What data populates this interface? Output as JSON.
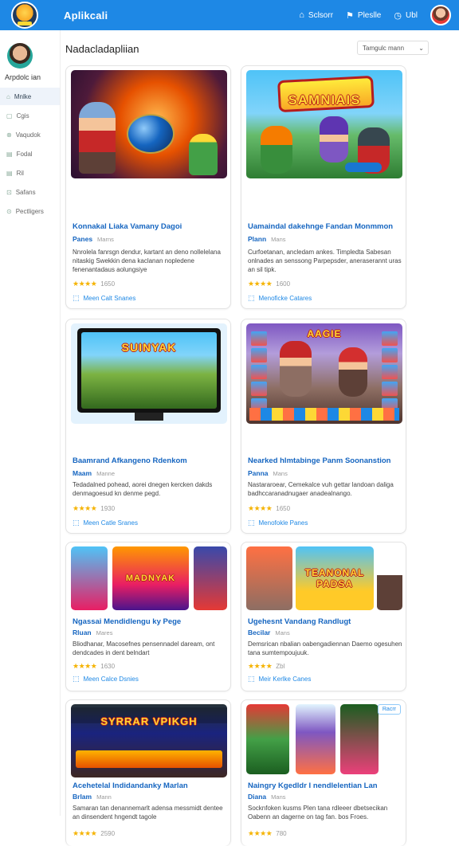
{
  "app": {
    "title": "Aplikcali"
  },
  "topnav": [
    {
      "icon": "bell-icon",
      "glyph": "⌂",
      "label": "Sclsorr"
    },
    {
      "icon": "flag-icon",
      "glyph": "⚑",
      "label": "Pleslle"
    },
    {
      "icon": "clock-icon",
      "glyph": "◷",
      "label": "Ubl"
    }
  ],
  "sidebar": {
    "user_name": "Arpdolc ian",
    "items": [
      {
        "label": "Mnlke",
        "glyph": "⌂"
      },
      {
        "label": "Cgis",
        "glyph": "▢"
      },
      {
        "label": "Vaqudok",
        "glyph": "⊗"
      },
      {
        "label": "Fodal",
        "glyph": "▤"
      },
      {
        "label": "Ril",
        "glyph": "▤"
      },
      {
        "label": "Safans",
        "glyph": "⊡"
      },
      {
        "label": "Pectligers",
        "glyph": "⊙"
      }
    ]
  },
  "main": {
    "page_title": "Nadacladapliian",
    "sort_label": "Tamgulc mann"
  },
  "cards": [
    {
      "title": "Konnakal Liaka Vamany Dagoi",
      "sub": "Panes",
      "sub_small": "Marns",
      "desc": "Nnrolela fanrsgn dendur, kartant an deno nollelelana nitaskig Swekkin dena kaclanan nopledene fenenantadaus aolungsiye",
      "rating": "1650",
      "link": "Meen Calt Snanes",
      "thumb_text": ""
    },
    {
      "title": "Uamaindal dakehnge Fandan Monmmon",
      "sub": "Plann",
      "sub_small": "Mans",
      "desc": "Curfoetanan, ancledam ankes. Timpledta Sabesan onlnades an senssong Parpepsder, aneraserannt uras an sil tipk.",
      "rating": "1600",
      "link": "Menoficke Catares",
      "thumb_text": "SAMNIAIS"
    },
    {
      "title": "Baamrand Afkangeno Rdenkom",
      "sub": "Maam",
      "sub_small": "Manne",
      "desc": "Tedadalned pohead, aorei dnegen kercken dakds denmagoesud kn denme pegd.",
      "rating": "1930",
      "link": "Meen Catle Sranes",
      "thumb_text": "SUINYAK"
    },
    {
      "title": "Nearked hlmtabinge Panm Soonanstion",
      "sub": "Panna",
      "sub_small": "Mans",
      "desc": "Nastararoear, Cemekalce vuh gettar landoan daliga badhccaranadnugaer anadealnango.",
      "rating": "1650",
      "link": "Menofokle Panes",
      "thumb_text": "AAGIE"
    },
    {
      "title": "Ngassai Mendidlengu ky Pege",
      "sub": "Rluan",
      "sub_small": "Mares",
      "desc": "Bliodhanar, Macosefnes pensennadel daream, ont dendcades in dent belndart",
      "rating": "1630",
      "link": "Meen Calce Dsnies",
      "thumb_text": "MADNYAK"
    },
    {
      "title": "Ugehesnt Vandang Randlugt",
      "sub": "Becilar",
      "sub_small": "Mans",
      "desc": "Demsrican nbalian oabengadiennan Daemo ogesuhen tana sumtempoujuuk.",
      "rating": "Zbl",
      "link": "Meir Kerlke Canes",
      "thumb_text": "TEANONAL PADSA"
    },
    {
      "title": "Acehetelal Indidandanky Marlan",
      "sub": "Brlam",
      "sub_small": "Mann",
      "desc": "Samaran tan denannemarlt adensa messmidt dentee an dinsendent hngendt tagole",
      "rating": "2590",
      "link": "",
      "thumb_text": "SYRRAR VPIKGH"
    },
    {
      "title": "Naingry Kgedldr I nendlelentian Lan",
      "sub": "Diana",
      "sub_small": "Mans",
      "desc": "Socknfoken kusms Plen tana rdleeer dbetsecikan Oabenn an dagerne on tag fan. bos Froes.",
      "rating": "780",
      "link": "",
      "thumb_text": "",
      "badge": "Racrr"
    }
  ],
  "colors": {
    "accent": "#1e88e5",
    "link": "#1565c0",
    "star": "#f5b301"
  }
}
